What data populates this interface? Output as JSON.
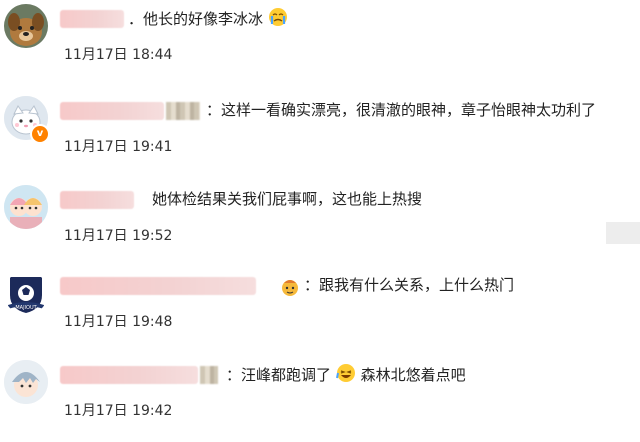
{
  "comments": [
    {
      "avatar": "dog-photo-avatar",
      "text": "．他长的好像李冰冰",
      "emoji": "crying-face-emoji",
      "time": "11月17日  18:44"
    },
    {
      "avatar": "cartoon-cat-avatar",
      "verified": "v",
      "text": "：这样一看确实漂亮，很清澈的眼神，章子怡眼神太功利了",
      "time": "11月17日  19:41"
    },
    {
      "avatar": "cartoon-couple-avatar",
      "text": "她体检结果关我们屁事啊，这也能上热搜",
      "time": "11月17日  19:52"
    },
    {
      "avatar": "football-club-avatar",
      "badge_text": "MAJIOUT",
      "text": "：跟我有什么关系，上什么热门",
      "time": "11月17日  19:48"
    },
    {
      "avatar": "anime-boy-avatar",
      "text_before": "：汪峰都跑调了",
      "emoji": "laughing-face-emoji",
      "text_after": "森林北悠着点吧",
      "time": "11月17日  19:42"
    }
  ],
  "colors": {
    "text": "#222222",
    "time": "#333333",
    "name_blur": "#f3d3d3",
    "verified_badge": "#ff8200"
  }
}
